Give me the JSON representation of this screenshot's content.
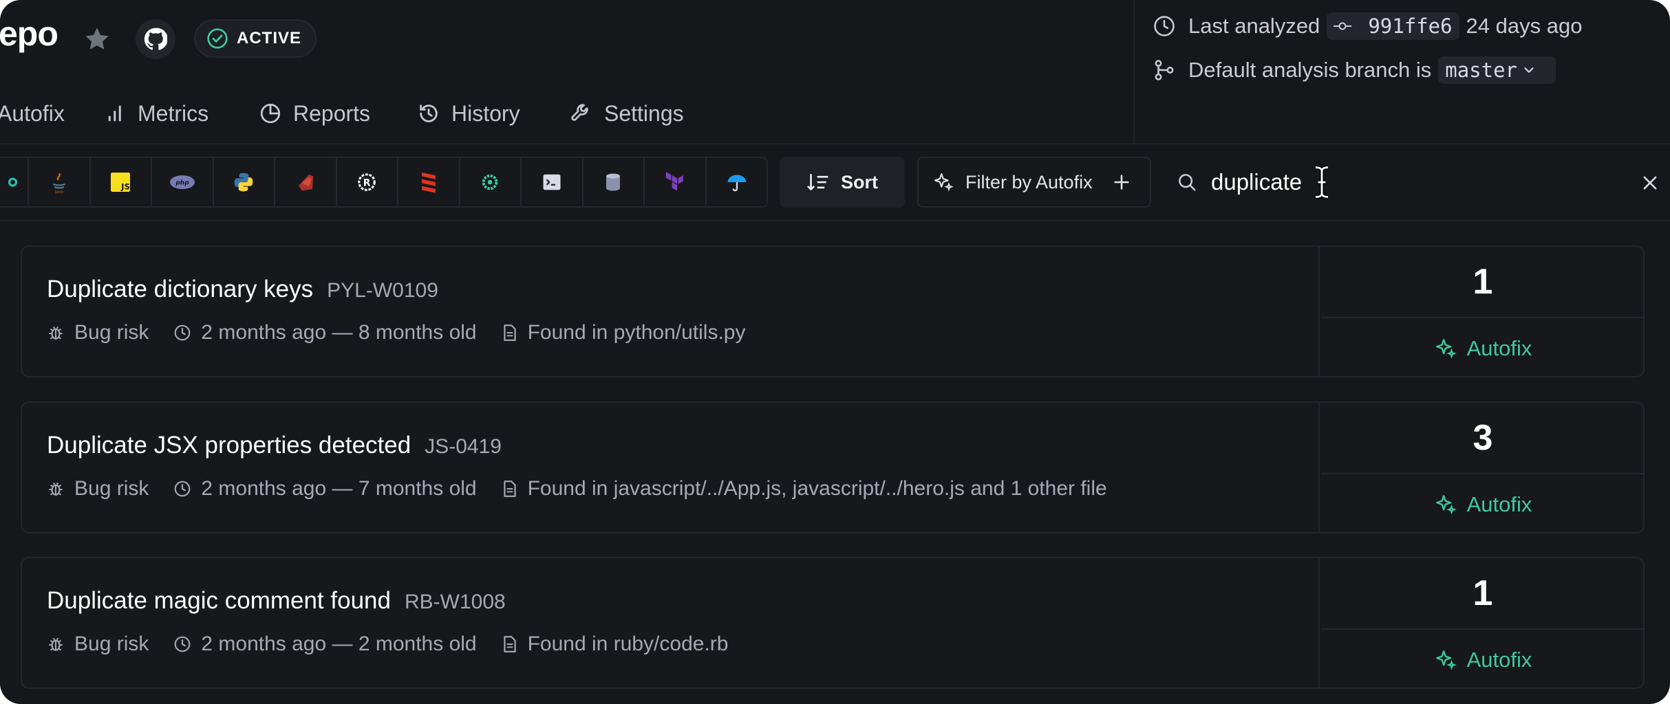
{
  "header": {
    "repo_title": "epo",
    "status": "ACTIVE",
    "last_analyzed_label": "Last analyzed",
    "commit": "991ffe6",
    "analyzed_ago": "24 days ago",
    "default_branch_label": "Default analysis branch is",
    "branch": "master"
  },
  "nav": [
    {
      "label": "Autofix",
      "icon": "sparkle-icon"
    },
    {
      "label": "Metrics",
      "icon": "bar-chart-icon"
    },
    {
      "label": "Reports",
      "icon": "pie-chart-icon"
    },
    {
      "label": "History",
      "icon": "history-icon"
    },
    {
      "label": "Settings",
      "icon": "wrench-icon"
    }
  ],
  "languages": [
    "go",
    "java",
    "javascript",
    "php",
    "python",
    "ruby",
    "rust",
    "scala",
    "kotlin",
    "shell",
    "sql",
    "terraform",
    "docker"
  ],
  "toolbar": {
    "sort_label": "Sort",
    "filter_label": "Filter by Autofix",
    "search_value": "duplicate"
  },
  "issues": [
    {
      "title": "Duplicate dictionary keys",
      "code": "PYL-W0109",
      "category": "Bug risk",
      "age": "2 months ago — 8 months old",
      "found": "Found in python/utils.py",
      "count": "1",
      "action": "Autofix"
    },
    {
      "title": "Duplicate JSX properties detected",
      "code": "JS-0419",
      "category": "Bug risk",
      "age": "2 months ago — 7 months old",
      "found": "Found in javascript/../App.js, javascript/../hero.js and 1 other file",
      "count": "3",
      "action": "Autofix"
    },
    {
      "title": "Duplicate magic comment found",
      "code": "RB-W1008",
      "category": "Bug risk",
      "age": "2 months ago — 2 months old",
      "found": "Found in ruby/code.rb",
      "count": "1",
      "action": "Autofix"
    }
  ],
  "colors": {
    "background": "#16171b",
    "accent": "#3ec99a",
    "card_border": "#24262c"
  }
}
